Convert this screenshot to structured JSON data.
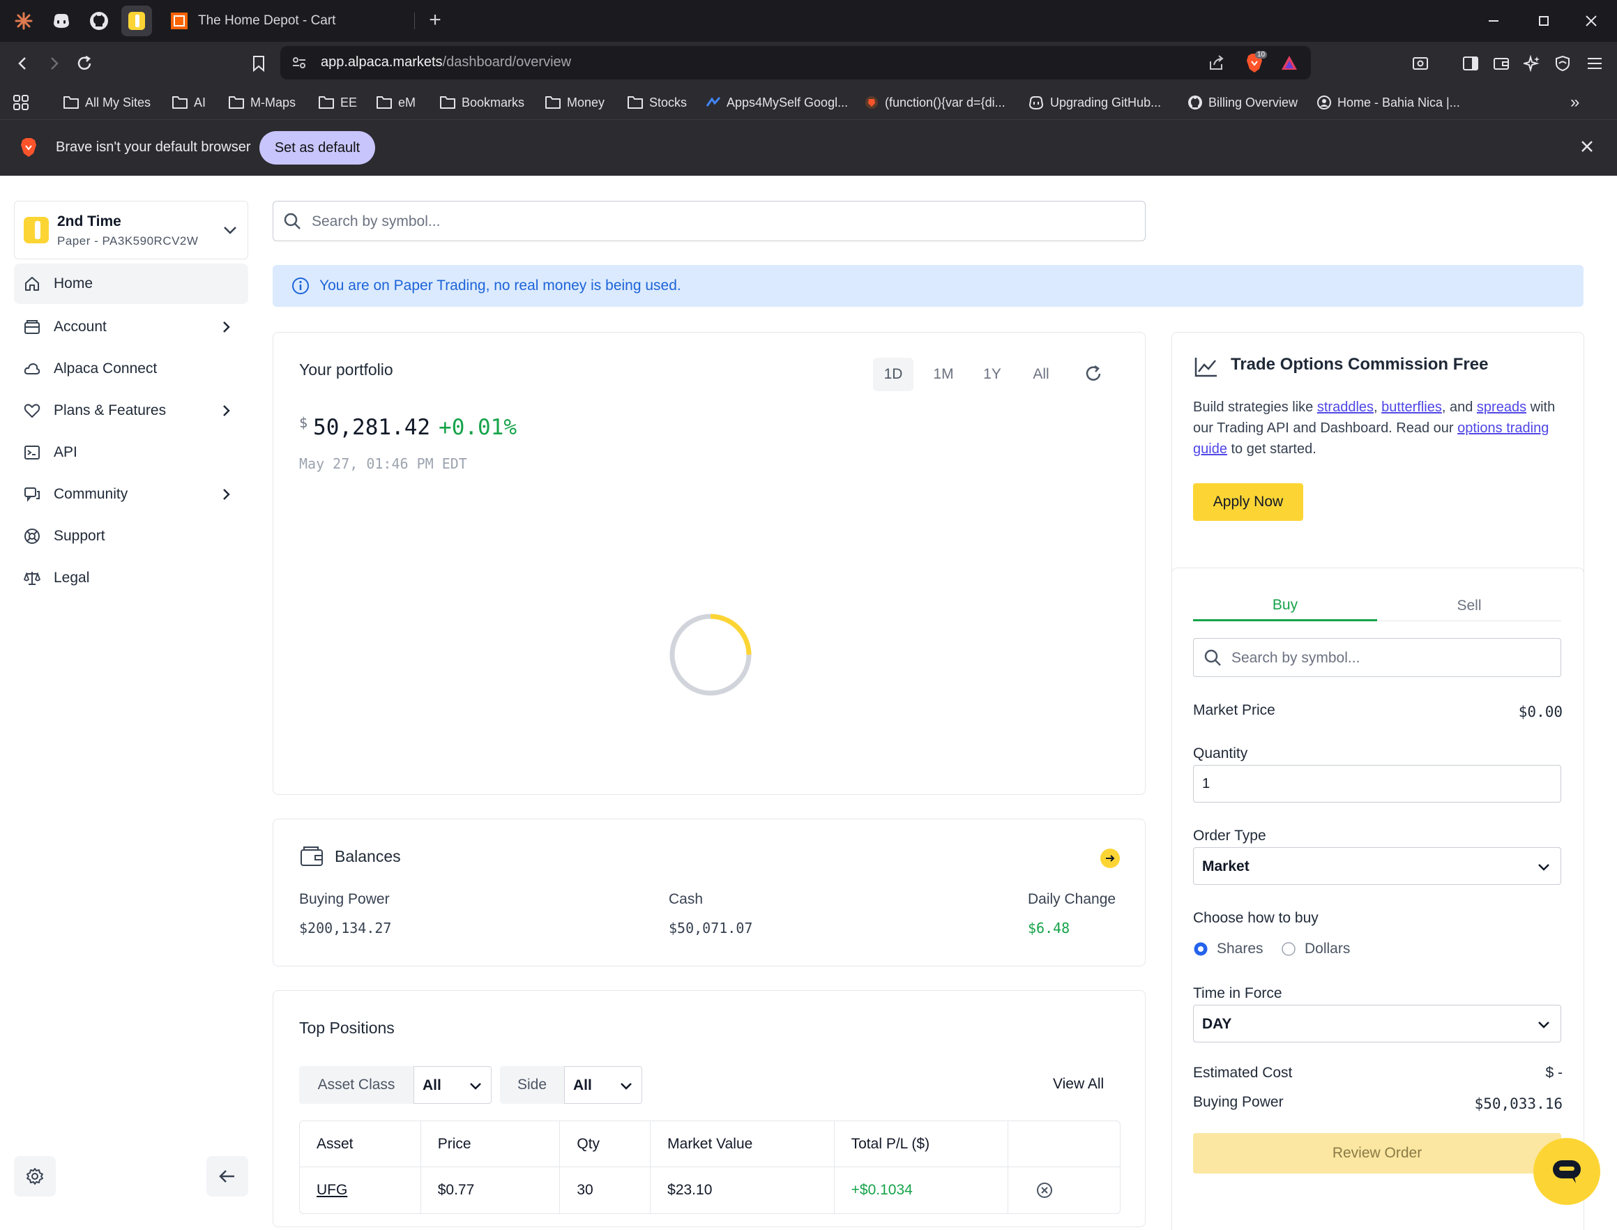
{
  "browser": {
    "tab": {
      "title": "The Home Depot - Cart"
    },
    "url": {
      "host": "app.alpaca.markets",
      "path": "/dashboard/overview"
    },
    "shields_count": "10",
    "bookmarks": [
      {
        "label": "All My Sites",
        "icon": "folder-icon"
      },
      {
        "label": "AI",
        "icon": "folder-icon"
      },
      {
        "label": "M-Maps",
        "icon": "folder-icon"
      },
      {
        "label": "EE",
        "icon": "folder-icon"
      },
      {
        "label": "eM",
        "icon": "folder-icon"
      },
      {
        "label": "Bookmarks",
        "icon": "folder-icon"
      },
      {
        "label": "Money",
        "icon": "folder-icon"
      },
      {
        "label": "Stocks",
        "icon": "folder-icon"
      },
      {
        "label": "Apps4MySelf Googl...",
        "icon": "apps-script-icon"
      },
      {
        "label": "(function(){var d={di...",
        "icon": "brave-icon"
      },
      {
        "label": "Upgrading GitHub...",
        "icon": "copilot-icon"
      },
      {
        "label": "Billing Overview",
        "icon": "github-icon"
      },
      {
        "label": "Home - Bahia Nica |...",
        "icon": "site-icon"
      }
    ],
    "infobar": {
      "text": "Brave isn't your default browser",
      "button": "Set as default"
    }
  },
  "account": {
    "name": "2nd Time",
    "subtitle": "Paper - PA3K590RCV2W"
  },
  "sidebar": {
    "items": [
      {
        "label": "Home",
        "icon": "home-icon",
        "active": true,
        "chevron": false
      },
      {
        "label": "Account",
        "icon": "wallet-icon",
        "active": false,
        "chevron": true
      },
      {
        "label": "Alpaca Connect",
        "icon": "cloud-icon",
        "active": false,
        "chevron": false
      },
      {
        "label": "Plans & Features",
        "icon": "heart-icon",
        "active": false,
        "chevron": true
      },
      {
        "label": "API",
        "icon": "terminal-icon",
        "active": false,
        "chevron": false
      },
      {
        "label": "Community",
        "icon": "chat-icon",
        "active": false,
        "chevron": true
      },
      {
        "label": "Support",
        "icon": "lifebuoy-icon",
        "active": false,
        "chevron": false
      },
      {
        "label": "Legal",
        "icon": "scale-icon",
        "active": false,
        "chevron": false
      }
    ]
  },
  "search": {
    "placeholder": "Search by symbol..."
  },
  "notice": {
    "text": "You are on Paper Trading, no real money is being used."
  },
  "portfolio": {
    "title": "Your portfolio",
    "ranges": [
      "1D",
      "1M",
      "1Y",
      "All"
    ],
    "selected_range": "1D",
    "currency": "$",
    "value": "50,281.42",
    "change_pct": "+0.01%",
    "timestamp": "May 27, 01:46 PM EDT"
  },
  "balances": {
    "title": "Balances",
    "items": [
      {
        "label": "Buying Power",
        "value": "$200,134.27"
      },
      {
        "label": "Cash",
        "value": "$50,071.07"
      },
      {
        "label": "Daily Change",
        "value": "$6.48"
      }
    ]
  },
  "positions": {
    "title": "Top Positions",
    "filters": [
      {
        "label": "Asset Class",
        "value": "All"
      },
      {
        "label": "Side",
        "value": "All"
      }
    ],
    "view_all": "View All",
    "columns": [
      "Asset",
      "Price",
      "Qty",
      "Market Value",
      "Total P/L ($)",
      ""
    ],
    "rows": [
      {
        "asset": "UFG",
        "price": "$0.77",
        "qty": "30",
        "market_value": "$23.10",
        "pl": "+$0.1034"
      }
    ]
  },
  "options_promo": {
    "title": "Trade Options Commission Free",
    "body": {
      "t1": "Build strategies like ",
      "l1": "straddles",
      "t2": ", ",
      "l2": "butterflies",
      "t3": ", and ",
      "l3": "spreads",
      "t4": " with our Trading API and Dashboard. Read our ",
      "l4": "options trading guide",
      "t5": " to get started."
    },
    "button": "Apply Now"
  },
  "trade": {
    "tabs": [
      "Buy",
      "Sell"
    ],
    "active_tab": "Buy",
    "search_placeholder": "Search by symbol...",
    "market_price_label": "Market Price",
    "market_price": "$0.00",
    "quantity_label": "Quantity",
    "quantity": "1",
    "order_type_label": "Order Type",
    "order_type": "Market",
    "how_label": "Choose how to buy",
    "how_options": [
      "Shares",
      "Dollars"
    ],
    "how_selected": "Shares",
    "tif_label": "Time in Force",
    "tif": "DAY",
    "est_cost_label": "Estimated Cost",
    "est_cost": "$ -",
    "buying_power_label": "Buying Power",
    "buying_power": "$50,033.16",
    "review_button": "Review Order"
  },
  "colors": {
    "brand_yellow": "#fcd535",
    "positive": "#16a34a",
    "notice_bg": "#dbeafe",
    "notice_text": "#1d64d8",
    "link": "#4f46e5"
  }
}
